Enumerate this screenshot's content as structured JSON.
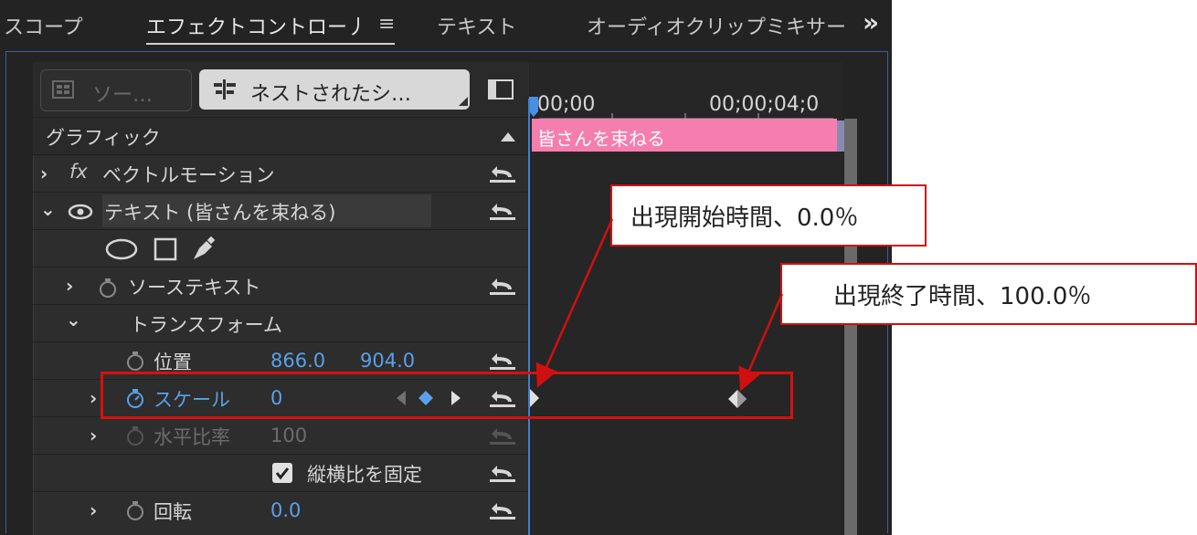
{
  "tabs": [
    {
      "label": "スコープ"
    },
    {
      "label": "エフェクトコントロー丿"
    },
    {
      "label": "テキスト"
    },
    {
      "label": "オーディオクリップミキサー"
    }
  ],
  "tab_menu_glyph": "≡",
  "tab_overflow_glyph": "»",
  "source_button": {
    "label": "ソー…"
  },
  "nested_button": {
    "label": "ネストされたシ…"
  },
  "timeline": {
    "time_start": "00;00",
    "time_end": "00;00;04;0",
    "clip_label": "皆さんを束ねる"
  },
  "section": {
    "label": "グラフィック"
  },
  "effects": {
    "vector_motion": {
      "fx": "fx",
      "label": "ベクトルモーション"
    },
    "text_layer": {
      "label": "テキスト (皆さんを束ねる)"
    },
    "source_text": {
      "label": "ソーステキスト"
    },
    "transform": {
      "label": "トランスフォーム"
    },
    "position": {
      "label": "位置",
      "x": "866.0",
      "y": "904.0"
    },
    "scale": {
      "label": "スケール",
      "value": "0"
    },
    "scale_width": {
      "label": "水平比率",
      "value": "100"
    },
    "uniform_scale": {
      "label": "縦横比を固定",
      "checked": true
    },
    "rotation": {
      "label": "回転",
      "value": "0.0"
    }
  },
  "callouts": {
    "start": "出現開始時間、0.0％",
    "end": "出現終了時間、100.0％"
  },
  "colors": {
    "panel_bg": "#232323",
    "clip": "#f57eae",
    "value_blue": "#5aa0e8",
    "annotation_red": "#d01010"
  }
}
